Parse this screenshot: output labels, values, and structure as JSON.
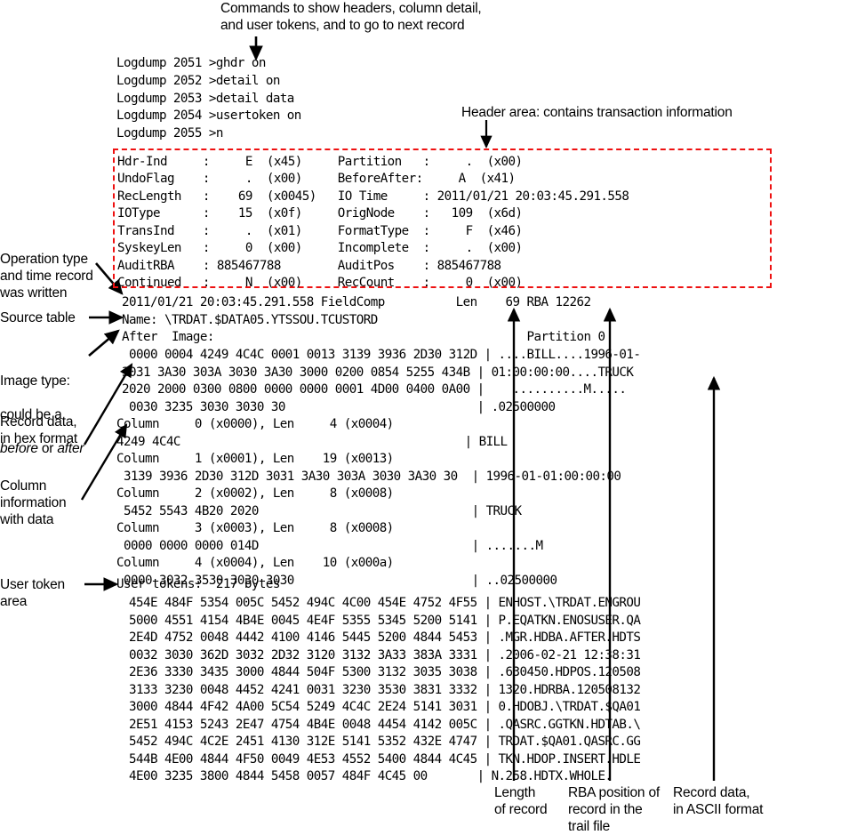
{
  "annotations": {
    "commands": "Commands to show headers, column detail,\nand user tokens, and to go to next record",
    "header_area": "Header area: contains transaction information",
    "operation_type": "Operation type\nand time record\nwas written",
    "source_table": "Source table",
    "image_type_line1": "Image type:",
    "image_type_line2": "could be a",
    "image_type_line3_pre": "",
    "image_type_before": "before",
    "image_type_or": " or ",
    "image_type_after": "after",
    "record_data_hex": "Record data,\nin hex format",
    "column_info": "Column\ninformation\nwith data",
    "user_token_area": "User token\narea",
    "length_of_record": "Length\nof record",
    "rba_position": "RBA position of\nrecord in the\ntrail file",
    "record_data_ascii": "Record data,\nin ASCII format"
  },
  "colors": {
    "header_box_border": "#ee1111",
    "text": "#000000",
    "background": "#ffffff"
  },
  "commands": {
    "lines": [
      "Logdump 2051 >ghdr on",
      "Logdump 2052 >detail on",
      "Logdump 2053 >detail data",
      "Logdump 2054 >usertoken on",
      "Logdump 2055 >n"
    ]
  },
  "header_block": {
    "lines": [
      "Hdr-Ind     :     E  (x45)     Partition   :     .  (x00)",
      "UndoFlag    :     .  (x00)     BeforeAfter:     A  (x41)",
      "RecLength   :    69  (x0045)   IO Time     : 2011/01/21 20:03:45.291.558",
      "IOType      :    15  (x0f)     OrigNode    :   109  (x6d)",
      "TransInd    :     .  (x01)     FormatType  :     F  (x46)",
      "SyskeyLen   :     0  (x00)     Incomplete  :     .  (x00)",
      "AuditRBA    : 885467788        AuditPos    : 885467788",
      "Continued   :     N  (x00)     RecCount    :     0  (x00)"
    ]
  },
  "record": {
    "summary_line": "2011/01/21 20:03:45.291.558 FieldComp          Len    69 RBA 12262",
    "name_line": "Name: \\TRDAT.$DATA05.YTSSOU.TCUSTORD",
    "image_line": "After  Image:                                            Partition 0",
    "dump_lines": [
      " 0000 0004 4249 4C4C 0001 0013 3139 3936 2D30 312D | ....BILL....1996-01-",
      "3031 3A30 303A 3030 3A30 3000 0200 0854 5255 434B | 01:00:00:00....TRUCK",
      "2020 2000 0300 0800 0000 0000 0001 4D00 0400 0A00 |    ..........M.....",
      " 0030 3235 3030 3030 30                           | .02500000"
    ],
    "columns": [
      {
        "header": "Column     0 (x0000), Len     4 (x0004)",
        "data": "4249 4C4C                                        | BILL"
      },
      {
        "header": "Column     1 (x0001), Len    19 (x0013)",
        "data": " 3139 3936 2D30 312D 3031 3A30 303A 3030 3A30 30  | 1996-01-01:00:00:00"
      },
      {
        "header": "Column     2 (x0002), Len     8 (x0008)",
        "data": " 5452 5543 4B20 2020                              | TRUCK"
      },
      {
        "header": "Column     3 (x0003), Len     8 (x0008)",
        "data": " 0000 0000 0000 014D                              | .......M"
      },
      {
        "header": "Column     4 (x0004), Len    10 (x000a)",
        "data": " 0000 3032 3530 3030 3030                         | ..02500000"
      }
    ]
  },
  "user_tokens": {
    "header": "User tokens:  217 bytes",
    "lines": [
      " 454E 484F 5354 005C 5452 494C 4C00 454E 4752 4F55 | ENHOST.\\TRDAT.ENGROU",
      " 5000 4551 4154 4B4E 0045 4E4F 5355 5345 5200 5141 | P.EQATKN.ENOSUSER.QA",
      " 2E4D 4752 0048 4442 4100 4146 5445 5200 4844 5453 | .MGR.HDBA.AFTER.HDTS",
      " 0032 3030 362D 3032 2D32 3120 3132 3A33 383A 3331 | .2006-02-21 12:38:31",
      " 2E36 3330 3435 3000 4844 504F 5300 3132 3035 3038 | .630450.HDPOS.120508",
      " 3133 3230 0048 4452 4241 0031 3230 3530 3831 3332 | 1320.HDRBA.120508132",
      " 3000 4844 4F42 4A00 5C54 5249 4C4C 2E24 5141 3031 | 0.HDOBJ.\\TRDAT.$QA01",
      " 2E51 4153 5243 2E47 4754 4B4E 0048 4454 4142 005C | .QASRC.GGTKN.HDTAB.\\",
      " 5452 494C 4C2E 2451 4130 312E 5141 5352 432E 4747 | TRDAT.$QA01.QASRC.GG",
      " 544B 4E00 4844 4F50 0049 4E53 4552 5400 4844 4C45 | TKN.HDOP.INSERT.HDLE",
      " 4E00 3235 3800 4844 5458 0057 484F 4C45 00       | N.258.HDTX.WHOLE."
    ]
  }
}
